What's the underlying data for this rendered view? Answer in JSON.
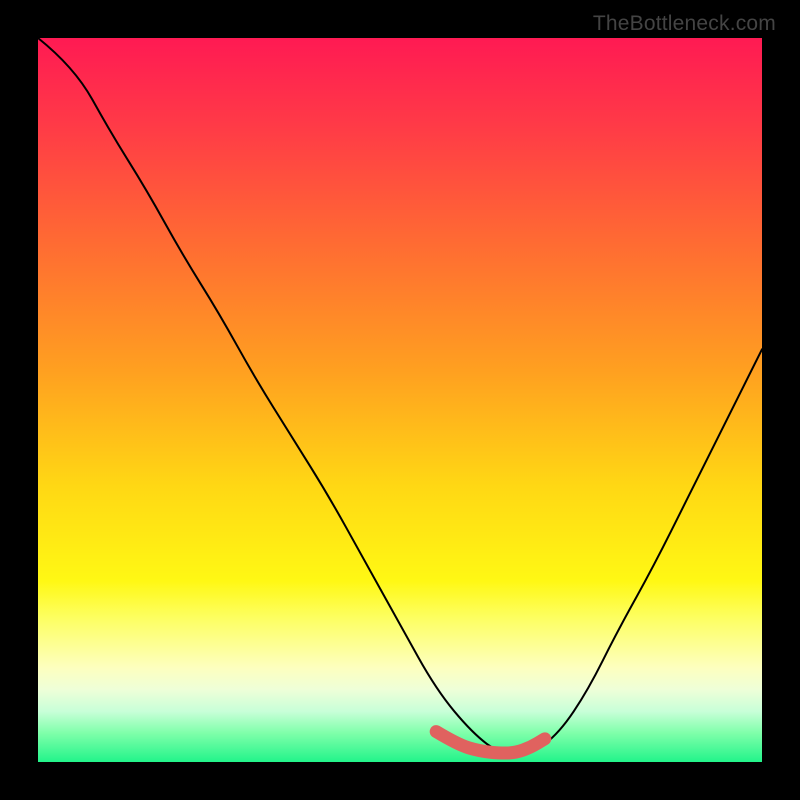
{
  "watermark": "TheBottleneck.com",
  "colors": {
    "curve_stroke": "#000000",
    "marker_stroke": "#e0625f",
    "background_black": "#000000"
  },
  "chart_data": {
    "type": "line",
    "title": "",
    "xlabel": "",
    "ylabel": "",
    "xlim": [
      0,
      100
    ],
    "ylim": [
      0,
      100
    ],
    "grid": false,
    "series": [
      {
        "name": "bottleneck-curve",
        "x": [
          0,
          5,
          10,
          15,
          20,
          25,
          30,
          35,
          40,
          45,
          50,
          55,
          60,
          64,
          68,
          72,
          76,
          80,
          85,
          90,
          95,
          100
        ],
        "y": [
          100,
          96,
          87,
          79,
          70,
          62,
          53,
          45,
          37,
          28,
          19,
          10,
          4,
          1,
          1,
          4,
          10,
          18,
          27,
          37,
          47,
          57
        ]
      }
    ],
    "annotations": [
      {
        "name": "valley-marker",
        "x": [
          55,
          58,
          61,
          64,
          66,
          68,
          70
        ],
        "y": [
          4.2,
          2.4,
          1.5,
          1.2,
          1.3,
          2.0,
          3.2
        ]
      }
    ]
  }
}
